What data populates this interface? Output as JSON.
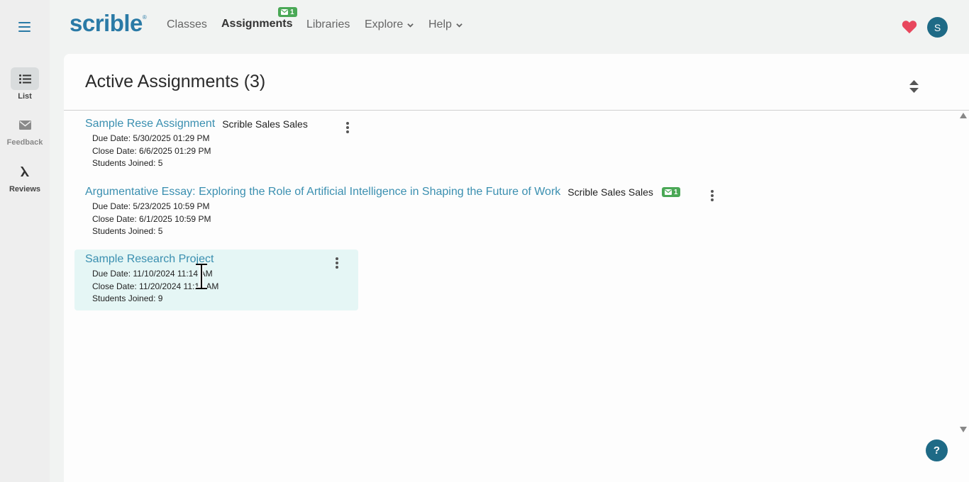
{
  "rail": {
    "items": [
      {
        "label": "List",
        "icon": "list-icon"
      },
      {
        "label": "Feedback",
        "icon": "envelope-icon"
      },
      {
        "label": "Reviews",
        "icon": "lambda-icon"
      }
    ]
  },
  "nav": {
    "logo": "scrible",
    "logo_mark": "®",
    "links": [
      "Classes",
      "Assignments",
      "Libraries",
      "Explore",
      "Help"
    ],
    "assignments_badge": "1",
    "avatar_initial": "S",
    "colors": {
      "brand": "#2a7aa6",
      "badge": "#4aa856",
      "heart": "#e8475d",
      "avatar": "#1e6a86"
    }
  },
  "main": {
    "title": "Active Assignments (3)",
    "assignments": [
      {
        "title": "Sample Rese Assignment",
        "class_name": "Scrible Sales Sales",
        "due": "Due Date: 5/30/2025 01:29 PM",
        "close": "Close Date: 6/6/2025 01:29 PM",
        "joined": "Students Joined: 5"
      },
      {
        "title": "Argumentative Essay: Exploring the Role of Artificial Intelligence in Shaping the Future of Work",
        "class_name": "Scrible Sales Sales",
        "badge": "1",
        "due": "Due Date: 5/23/2025 10:59 PM",
        "close": "Close Date: 6/1/2025 10:59 PM",
        "joined": "Students Joined: 5"
      },
      {
        "title": "Sample Research Project",
        "due": "Due Date: 11/10/2024 11:14 AM",
        "close": "Close Date: 11/20/2024 11:14 AM",
        "joined": "Students Joined: 9"
      }
    ]
  },
  "help_label": "?"
}
